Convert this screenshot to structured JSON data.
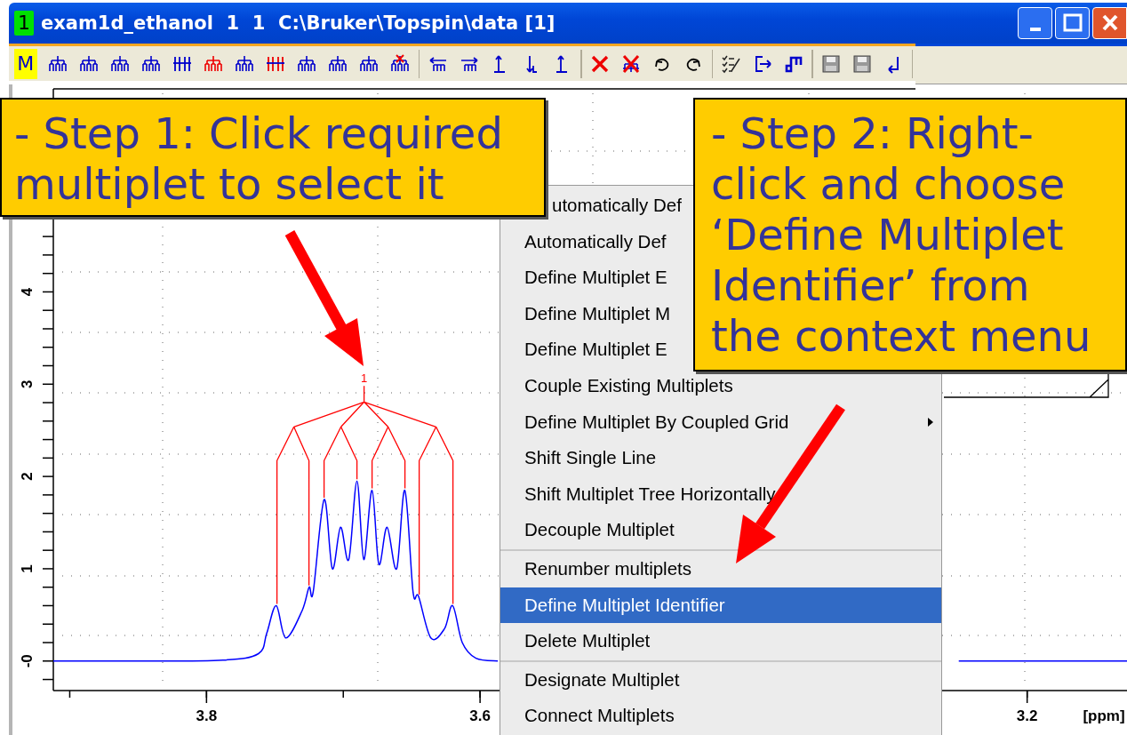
{
  "window": {
    "badge": "1",
    "title": "exam1d_ethanol  1  1  C:\\Bruker\\Topspin\\data [1]"
  },
  "toolbar": {
    "mode_button": "M"
  },
  "plot": {
    "chart_data": {
      "type": "line",
      "xlim": [
        3.912,
        3.127
      ],
      "ylim": [
        -0.32,
        6.2
      ],
      "xticks": [
        3.8,
        3.6,
        3.2
      ],
      "yticks": [
        {
          "value": 0,
          "label": "-0"
        },
        1,
        2,
        3,
        4
      ],
      "xlabel": "[ppm]",
      "x": [
        3.912,
        3.85,
        3.788,
        3.762,
        3.756,
        3.749,
        3.742,
        3.73,
        3.725,
        3.722,
        3.714,
        3.708,
        3.702,
        3.696,
        3.69,
        3.685,
        3.679,
        3.674,
        3.668,
        3.661,
        3.655,
        3.649,
        3.645,
        3.636,
        3.626,
        3.62,
        3.613,
        3.603,
        3.587,
        3.55,
        3.45,
        3.35,
        3.25,
        3.127
      ],
      "series": [
        {
          "color": "#0000ff",
          "values": [
            0,
            0,
            0.01,
            0.08,
            0.3,
            0.6,
            0.25,
            0.55,
            0.8,
            0.75,
            1.75,
            1.0,
            1.45,
            1.1,
            1.95,
            1.1,
            1.85,
            1.05,
            1.45,
            1.0,
            1.85,
            0.75,
            0.7,
            0.25,
            0.35,
            0.6,
            0.2,
            0.03,
            0,
            null,
            null,
            null,
            0,
            0
          ]
        }
      ],
      "annotations": [
        "1"
      ]
    }
  },
  "context_menu": {
    "items": [
      {
        "label": "utomatically Def",
        "kind": "partly_hidden",
        "selected": false
      },
      {
        "label": "Automatically Def",
        "kind": "item",
        "selected": false
      },
      {
        "label": "Define Multiplet E",
        "kind": "item",
        "selected": false
      },
      {
        "label": "Define Multiplet M",
        "kind": "item",
        "selected": false
      },
      {
        "label": "Define Multiplet E",
        "kind": "item",
        "selected": false
      },
      {
        "label": "Couple Existing Multiplets",
        "kind": "item",
        "selected": false
      },
      {
        "label": "Define Multiplet By Coupled Grid",
        "kind": "submenu",
        "selected": false
      },
      {
        "label": "Shift Single Line",
        "kind": "item",
        "selected": false
      },
      {
        "label": "Shift Multiplet Tree Horizontally",
        "kind": "item",
        "selected": false
      },
      {
        "label": "Decouple Multiplet",
        "kind": "item",
        "selected": false
      },
      {
        "label": "Renumber multiplets",
        "kind": "separated",
        "selected": false
      },
      {
        "label": "Define Multiplet Identifier",
        "kind": "item",
        "selected": true
      },
      {
        "label": "Delete Multiplet",
        "kind": "item",
        "selected": false
      },
      {
        "label": "Designate Multiplet",
        "kind": "separated",
        "selected": false
      },
      {
        "label": "Connect Multiplets",
        "kind": "item",
        "selected": false
      }
    ]
  },
  "callouts": [
    {
      "text": "- Step 1: Click required multiplet to select it"
    },
    {
      "text": "- Step 2: Right-click and choose ‘Define Multiplet Identifier’ from the context menu"
    }
  ]
}
